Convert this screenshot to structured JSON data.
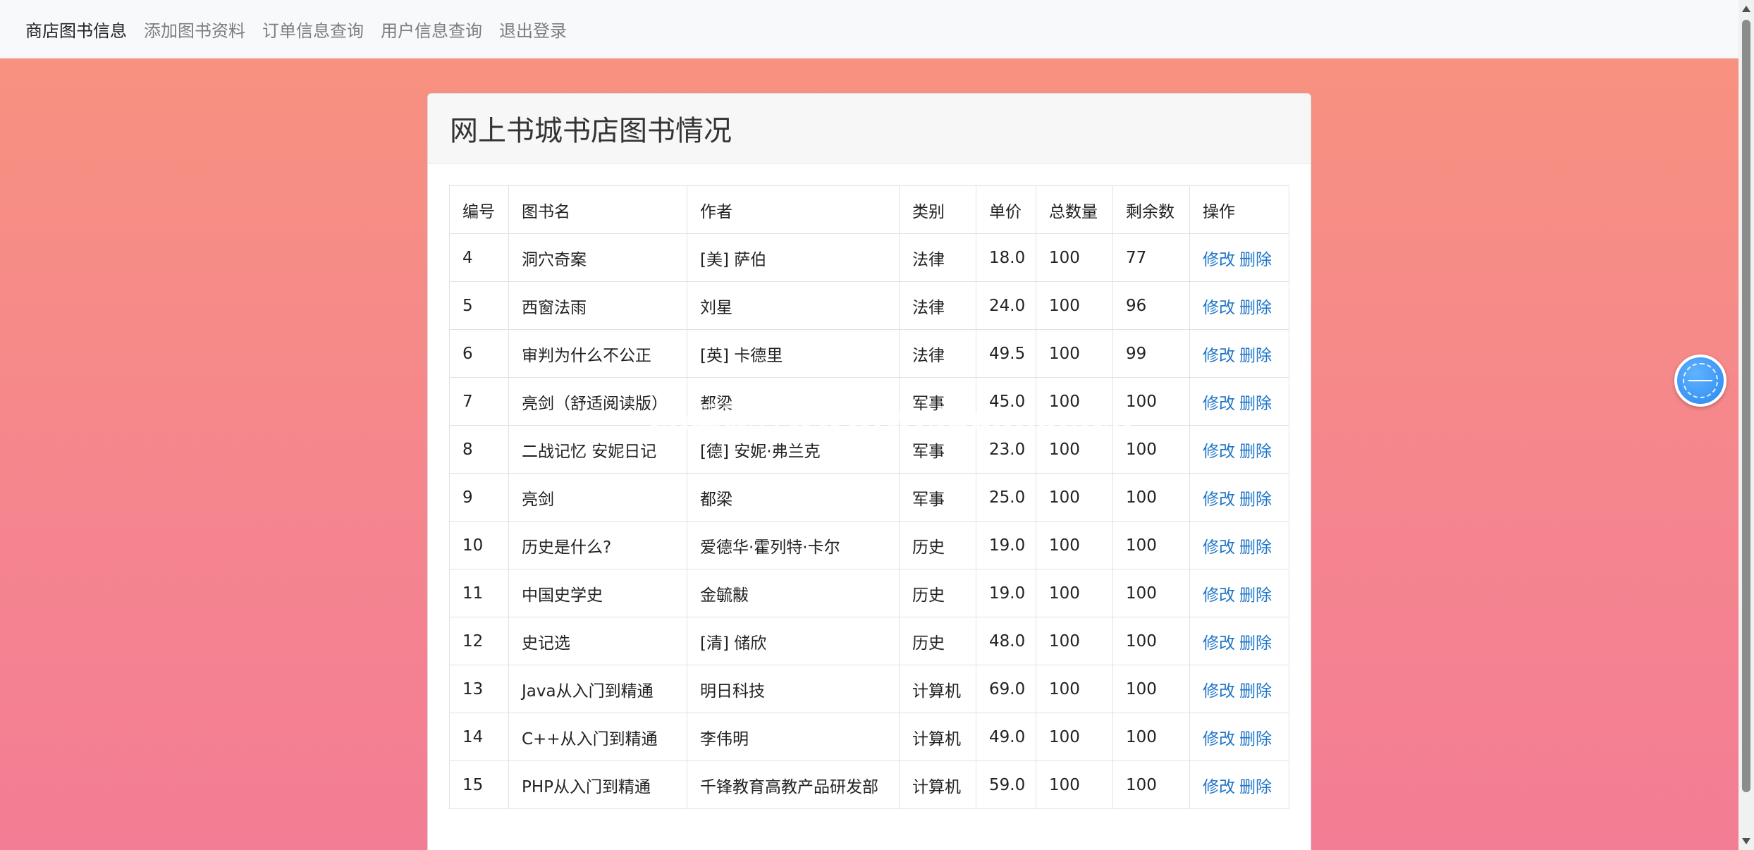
{
  "nav": {
    "items": [
      {
        "label": "商店图书信息",
        "active": true
      },
      {
        "label": "添加图书资料",
        "active": false
      },
      {
        "label": "订单信息查询",
        "active": false
      },
      {
        "label": "用户信息查询",
        "active": false
      },
      {
        "label": "退出登录",
        "active": false
      }
    ]
  },
  "card": {
    "title": "网上书城书店图书情况"
  },
  "table": {
    "headers": [
      "编号",
      "图书名",
      "作者",
      "类别",
      "单价",
      "总数量",
      "剩余数",
      "操作"
    ],
    "edit_label": "修改",
    "delete_label": "删除",
    "rows": [
      {
        "id": "4",
        "name": "洞穴奇案",
        "author": "[美] 萨伯",
        "category": "法律",
        "price": "18.0",
        "total": "100",
        "remaining": "77"
      },
      {
        "id": "5",
        "name": "西窗法雨",
        "author": "刘星",
        "category": "法律",
        "price": "24.0",
        "total": "100",
        "remaining": "96"
      },
      {
        "id": "6",
        "name": "审判为什么不公正",
        "author": "[英] 卡德里",
        "category": "法律",
        "price": "49.5",
        "total": "100",
        "remaining": "99"
      },
      {
        "id": "7",
        "name": "亮剑（舒适阅读版）",
        "author": "都梁",
        "category": "军事",
        "price": "45.0",
        "total": "100",
        "remaining": "100"
      },
      {
        "id": "8",
        "name": "二战记忆 安妮日记",
        "author": "[德] 安妮·弗兰克",
        "category": "军事",
        "price": "23.0",
        "total": "100",
        "remaining": "100"
      },
      {
        "id": "9",
        "name": "亮剑",
        "author": "都梁",
        "category": "军事",
        "price": "25.0",
        "total": "100",
        "remaining": "100"
      },
      {
        "id": "10",
        "name": "历史是什么?",
        "author": "爱德华·霍列特·卡尔",
        "category": "历史",
        "price": "19.0",
        "total": "100",
        "remaining": "100"
      },
      {
        "id": "11",
        "name": "中国史学史",
        "author": "金毓黻",
        "category": "历史",
        "price": "19.0",
        "total": "100",
        "remaining": "100"
      },
      {
        "id": "12",
        "name": "史记选",
        "author": "[清] 储欣",
        "category": "历史",
        "price": "48.0",
        "total": "100",
        "remaining": "100"
      },
      {
        "id": "13",
        "name": "Java从入门到精通",
        "author": "明日科技",
        "category": "计算机",
        "price": "69.0",
        "total": "100",
        "remaining": "100"
      },
      {
        "id": "14",
        "name": "C++从入门到精通",
        "author": "李伟明",
        "category": "计算机",
        "price": "49.0",
        "total": "100",
        "remaining": "100"
      },
      {
        "id": "15",
        "name": "PHP从入门到精通",
        "author": "千锋教育高教产品研发部",
        "category": "计算机",
        "price": "59.0",
        "total": "100",
        "remaining": "100"
      }
    ]
  },
  "watermark": {
    "text": "cn国观客www.weiguanke.cn"
  },
  "floating_widget": {
    "icon": "floating-assistant-icon"
  }
}
